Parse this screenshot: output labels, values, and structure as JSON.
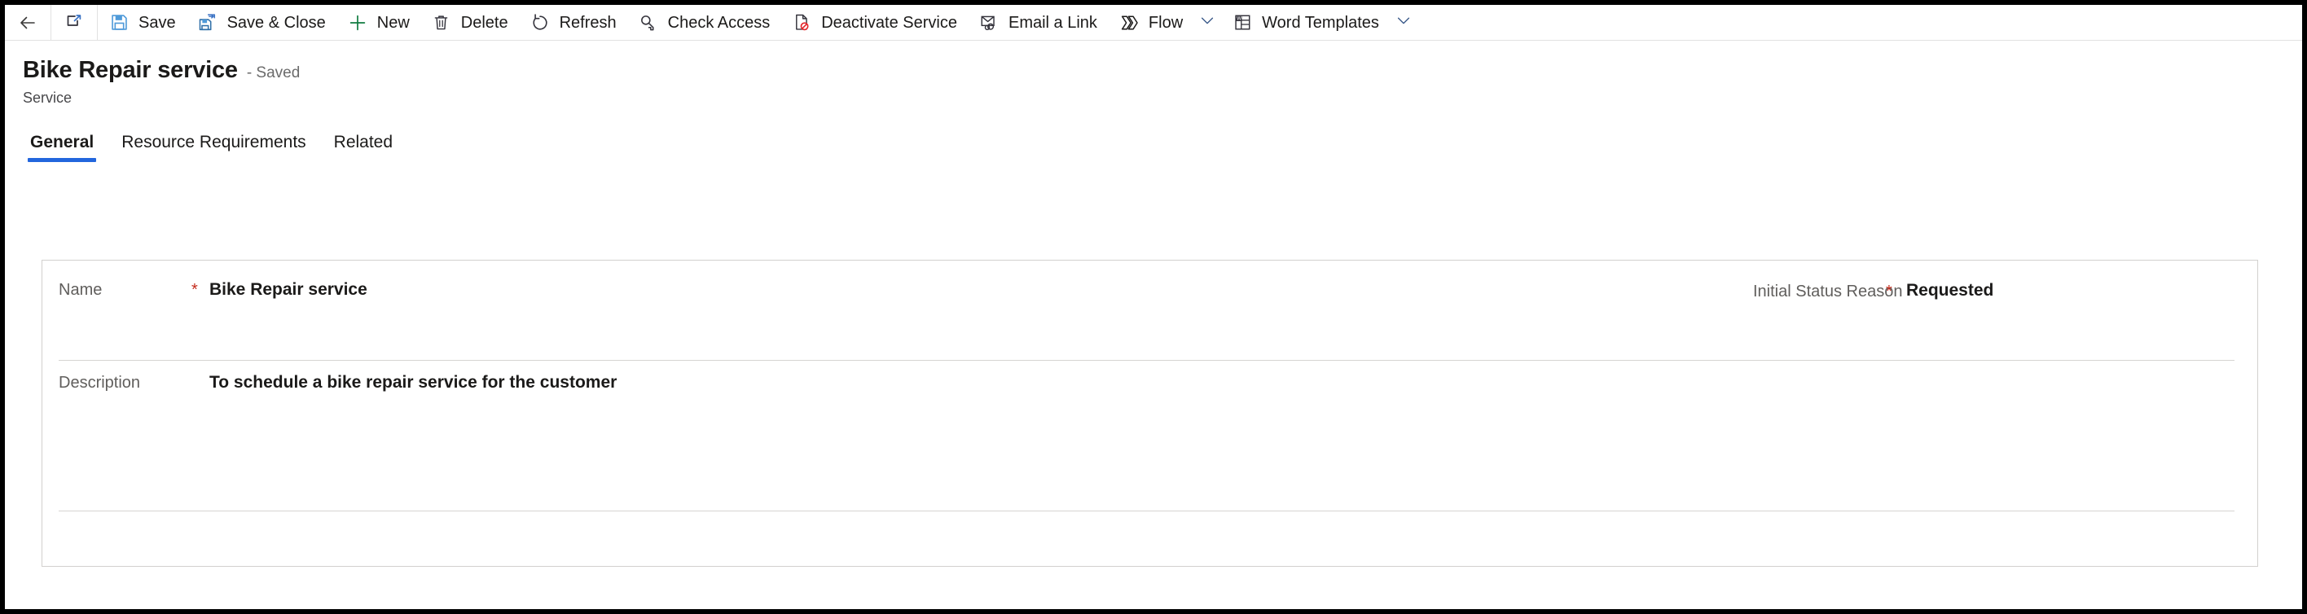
{
  "commandbar": {
    "items": [
      {
        "id": "back",
        "icon": "back-arrow-icon",
        "label": ""
      },
      {
        "id": "popout",
        "icon": "open-in-new-window-icon",
        "label": ""
      },
      {
        "id": "save",
        "icon": "save-icon",
        "label": "Save"
      },
      {
        "id": "save-close",
        "icon": "save-and-close-icon",
        "label": "Save & Close"
      },
      {
        "id": "new",
        "icon": "plus-icon",
        "label": "New"
      },
      {
        "id": "delete",
        "icon": "trash-icon",
        "label": "Delete"
      },
      {
        "id": "refresh",
        "icon": "refresh-icon",
        "label": "Refresh"
      },
      {
        "id": "check-access",
        "icon": "key-icon",
        "label": "Check Access"
      },
      {
        "id": "deactivate",
        "icon": "deactivate-icon",
        "label": "Deactivate Service"
      },
      {
        "id": "email-link",
        "icon": "email-link-icon",
        "label": "Email a Link"
      },
      {
        "id": "flow",
        "icon": "flow-icon",
        "label": "Flow"
      },
      {
        "id": "word-templates",
        "icon": "word-icon",
        "label": "Word Templates"
      }
    ]
  },
  "header": {
    "title": "Bike Repair service",
    "save_state": "- Saved",
    "entity": "Service"
  },
  "tabs": [
    {
      "label": "General",
      "active": true
    },
    {
      "label": "Resource Requirements",
      "active": false
    },
    {
      "label": "Related",
      "active": false
    }
  ],
  "form": {
    "name": {
      "label": "Name",
      "required": "*",
      "value": "Bike Repair service"
    },
    "initial_status_reason": {
      "label": "Initial Status Reason",
      "required": "*",
      "value": "Requested"
    },
    "description": {
      "label": "Description",
      "value": "To schedule a bike repair service for the customer"
    }
  },
  "colors": {
    "accent": "#2266dd",
    "required": "#c42b1c",
    "save_icon": "#4f9ad9",
    "new_icon": "#107c41",
    "label": "#605e5c",
    "border": "#d2d0ce"
  }
}
